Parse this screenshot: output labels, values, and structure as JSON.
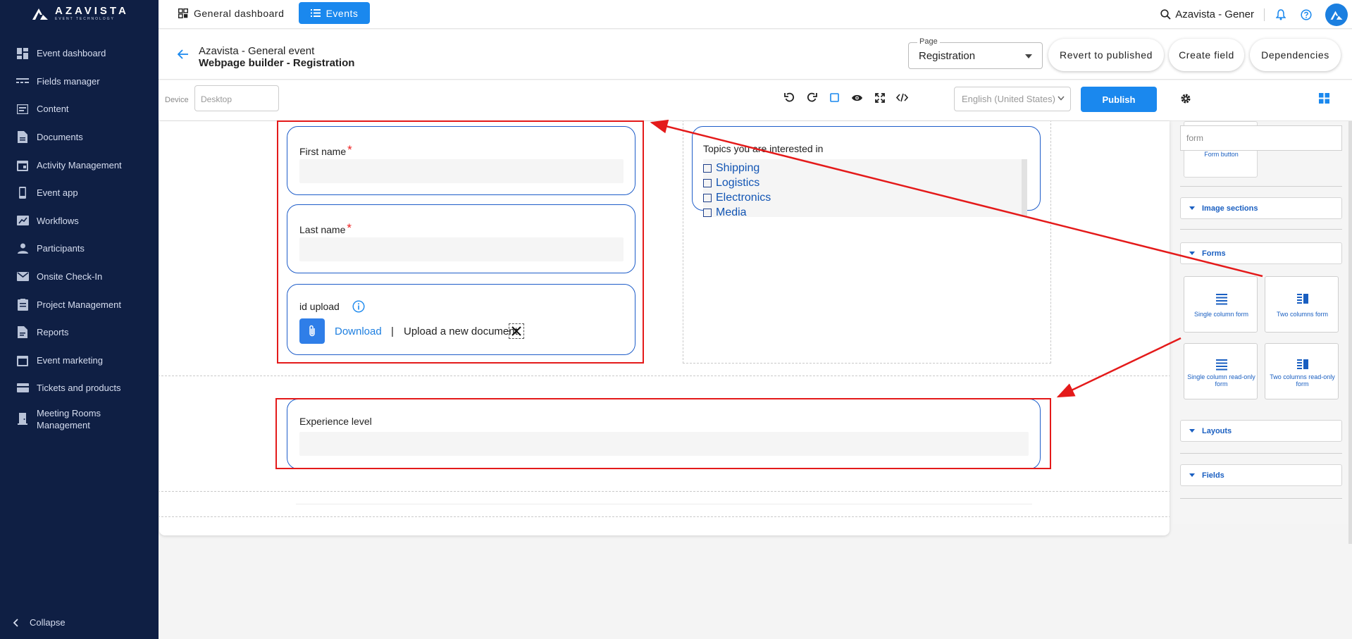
{
  "app": {
    "logo_name": "AZAVISTA",
    "logo_sub": "EVENT TECHNOLOGY"
  },
  "sidebar": {
    "items": [
      {
        "label": "Event dashboard",
        "icon": "dashboard-icon"
      },
      {
        "label": "Fields manager",
        "icon": "fields-icon"
      },
      {
        "label": "Content",
        "icon": "content-icon"
      },
      {
        "label": "Documents",
        "icon": "document-icon"
      },
      {
        "label": "Activity Management",
        "icon": "calendar-icon"
      },
      {
        "label": "Event app",
        "icon": "phone-icon"
      },
      {
        "label": "Workflows",
        "icon": "workflow-icon"
      },
      {
        "label": "Participants",
        "icon": "person-icon"
      },
      {
        "label": "Onsite Check-In",
        "icon": "mail-icon"
      },
      {
        "label": "Project Management",
        "icon": "project-icon"
      },
      {
        "label": "Reports",
        "icon": "report-icon"
      },
      {
        "label": "Event marketing",
        "icon": "marketing-icon"
      },
      {
        "label": "Tickets and products",
        "icon": "ticket-icon"
      },
      {
        "label": "Meeting Rooms Management",
        "icon": "door-icon"
      }
    ],
    "collapse_label": "Collapse"
  },
  "topbar": {
    "general_tab": "General dashboard",
    "events_tab": "Events",
    "search_text": "Azavista - Gener"
  },
  "header": {
    "event_name": "Azavista - General event",
    "page_title": "Webpage builder - Registration",
    "page_legend": "Page",
    "page_value": "Registration",
    "revert_label": "Revert to published",
    "create_field_label": "Create field",
    "dependencies_label": "Dependencies"
  },
  "toolbar": {
    "device_label": "Device",
    "device_placeholder": "Desktop",
    "language": "English (United States)",
    "publish_label": "Publish"
  },
  "canvas": {
    "first_name_label": "First name",
    "last_name_label": "Last name",
    "required_mark": "*",
    "id_upload_label": "id upload",
    "download_label": "Download",
    "pipe": "|",
    "upload_new_label": "Upload a new document",
    "topics_label": "Topics you are interested in",
    "topics": [
      "Shipping",
      "Logistics",
      "Electronics",
      "Media"
    ],
    "experience_label": "Experience level"
  },
  "panel": {
    "search_value": "form",
    "ghost_label": "Form button",
    "sections": {
      "image_sections": "Image sections",
      "forms": "Forms",
      "layouts": "Layouts",
      "fields": "Fields"
    },
    "form_blocks": [
      {
        "label": "Single column form"
      },
      {
        "label": "Two columns form"
      },
      {
        "label": "Single column read-only form"
      },
      {
        "label": "Two columns read-only form"
      }
    ]
  },
  "colors": {
    "accent": "#1a88ee",
    "sidebar": "#0f1f44",
    "annotation": "#e41a1a",
    "field_border": "#1e5dc9"
  }
}
